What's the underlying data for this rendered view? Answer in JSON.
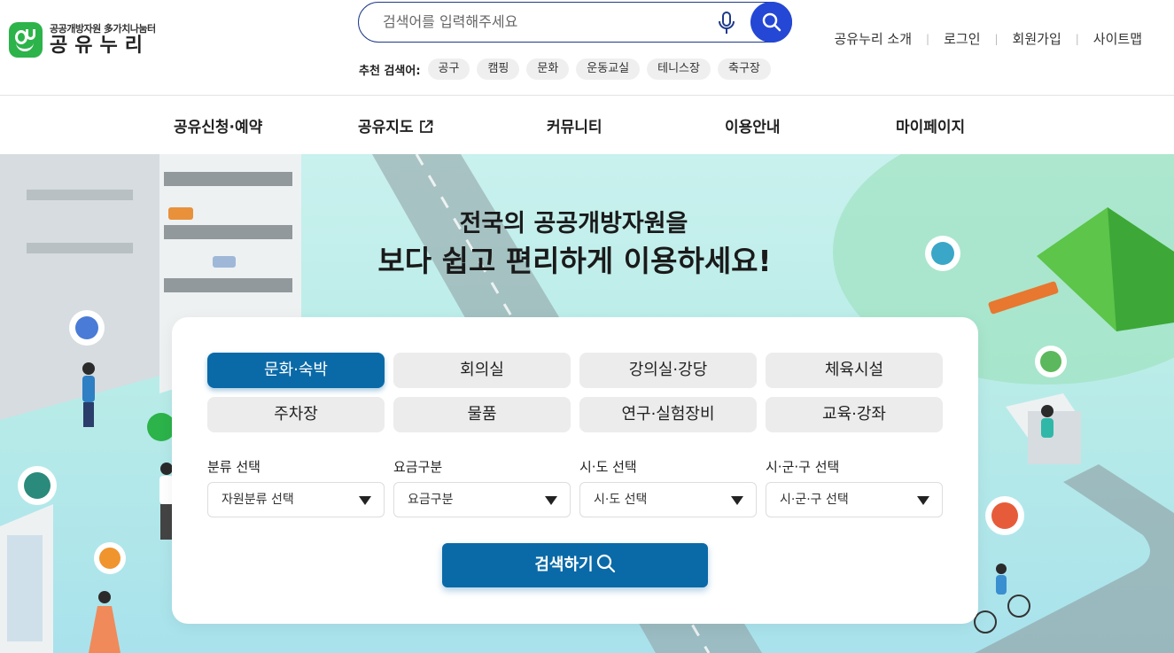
{
  "logo": {
    "subtitle": "공공개방자원 多가치나눔터",
    "title": "공유누리"
  },
  "search": {
    "placeholder": "검색어를 입력해주세요",
    "recommend_label": "추천 검색어:",
    "recommend_tags": [
      "공구",
      "캠핑",
      "문화",
      "운동교실",
      "테니스장",
      "축구장"
    ]
  },
  "util_nav": [
    "공유누리 소개",
    "로그인",
    "회원가입",
    "사이트맵"
  ],
  "gnb": [
    "공유신청·예약",
    "공유지도",
    "커뮤니티",
    "이용안내",
    "마이페이지"
  ],
  "hero": {
    "title1": "전국의 공공개방자원을",
    "title2": "보다 쉽고 편리하게 이용하세요!"
  },
  "categories": [
    "문화·숙박",
    "회의실",
    "강의실·강당",
    "체육시설",
    "주차장",
    "물품",
    "연구·실험장비",
    "교육·강좌"
  ],
  "active_category": "문화·숙박",
  "filters": [
    {
      "label": "분류 선택",
      "value": "자원분류 선택"
    },
    {
      "label": "요금구분",
      "value": "요금구분"
    },
    {
      "label": "시·도 선택",
      "value": "시·도 선택"
    },
    {
      "label": "시·군·구 선택",
      "value": "시·군·구 선택"
    }
  ],
  "submit_label": "검색하기",
  "colors": {
    "primary": "#0a6aa8",
    "search_button": "#2447d6",
    "brand_green": "#2cb34a",
    "hero_bg": "#c9f1ee"
  }
}
